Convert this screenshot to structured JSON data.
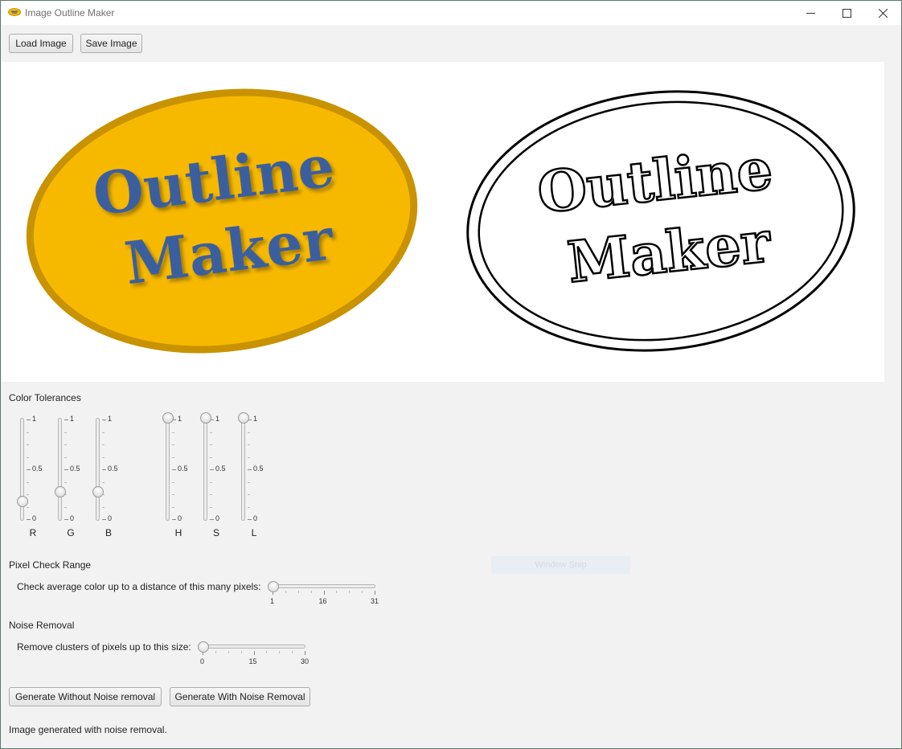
{
  "window": {
    "title": "Image Outline Maker",
    "controls": {
      "minimize": "minimize-icon",
      "maximize": "maximize-icon",
      "close": "close-icon"
    }
  },
  "toolbar": {
    "load_label": "Load Image",
    "save_label": "Save Image"
  },
  "images": {
    "original": {
      "line1": "Outline",
      "line2": "Maker",
      "fill": "#f7b900",
      "border": "#c89200",
      "text_color": "#3b5e9e"
    },
    "outline": {
      "line1": "Outline",
      "line2": "Maker",
      "stroke": "#000000"
    }
  },
  "color_tolerances": {
    "heading": "Color Tolerances",
    "tick_labels": [
      "1",
      "0.5",
      "0"
    ],
    "sliders": [
      {
        "label": "R",
        "value": 0.15
      },
      {
        "label": "G",
        "value": 0.25
      },
      {
        "label": "B",
        "value": 0.25
      },
      {
        "label": "H",
        "value": 1
      },
      {
        "label": "S",
        "value": 1
      },
      {
        "label": "L",
        "value": 1
      }
    ]
  },
  "pixel_check": {
    "heading": "Pixel Check Range",
    "prompt": "Check average color up to a distance of this many pixels:",
    "min": 1,
    "max": 31,
    "value": 1,
    "tick_labels": [
      "1",
      "16",
      "31"
    ]
  },
  "noise_removal": {
    "heading": "Noise Removal",
    "prompt": "Remove clusters of pixels up to this size:",
    "min": 0,
    "max": 30,
    "value": 0,
    "tick_labels": [
      "0",
      "15",
      "30"
    ]
  },
  "overlay": {
    "snip_label": "Window Snip"
  },
  "actions": {
    "generate_without_label": "Generate Without Noise removal",
    "generate_with_label": "Generate With Noise Removal"
  },
  "status": {
    "message": "Image generated with noise removal."
  }
}
